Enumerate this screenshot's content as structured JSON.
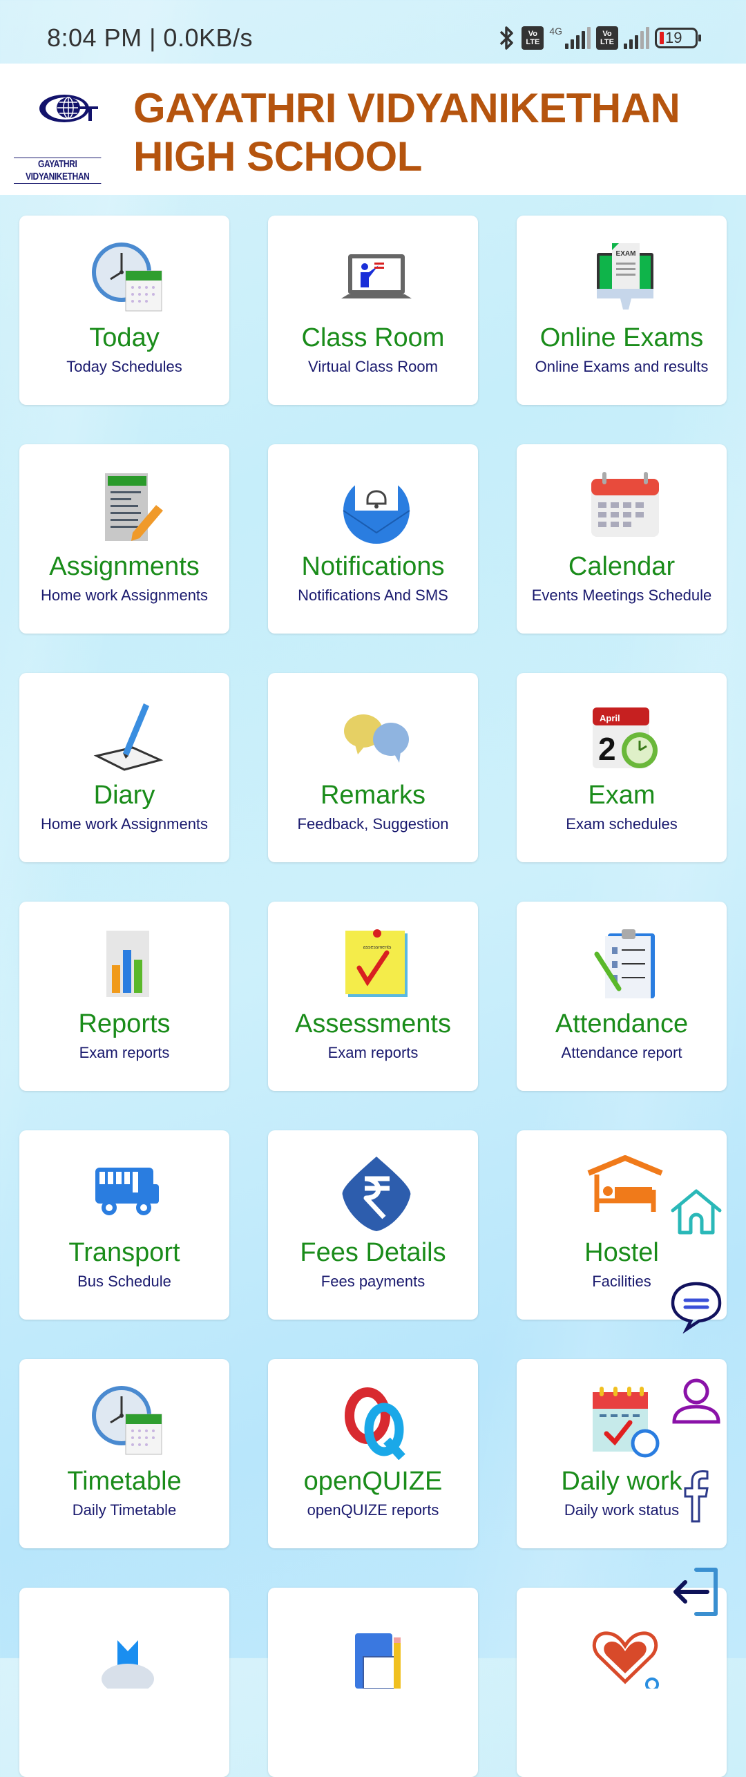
{
  "status_bar": {
    "time": "8:04 PM | 0.0KB/s",
    "network_type": "4G",
    "volte_label_top": "Vo",
    "volte_label_bottom": "LTE",
    "battery": "19",
    "icons": [
      "bluetooth-icon",
      "volte-icon",
      "signal-icon",
      "volte-icon",
      "signal-icon",
      "battery-icon"
    ]
  },
  "header": {
    "logo_caption": "GAYATHRI VIDYANIKETHAN",
    "school_name_line1": "GAYATHRI VIDYANIKETHAN",
    "school_name_line2": "HIGH SCHOOL"
  },
  "colors": {
    "title_green": "#1a8c1a",
    "subtitle_navy": "#1a1a6e",
    "school_name_orange": "#b5540e"
  },
  "tiles": [
    {
      "title": "Today",
      "subtitle": "Today Schedules",
      "icon": "clock-calendar-icon"
    },
    {
      "title": "Class Room",
      "subtitle": "Virtual Class Room",
      "icon": "laptop-teacher-icon"
    },
    {
      "title": "Online Exams",
      "subtitle": "Online Exams and results",
      "icon": "exam-monitor-icon"
    },
    {
      "title": "Assignments",
      "subtitle": "Home work Assignments",
      "icon": "document-pencil-icon"
    },
    {
      "title": "Notifications",
      "subtitle": "Notifications And SMS",
      "icon": "bell-envelope-icon"
    },
    {
      "title": "Calendar",
      "subtitle": "Events Meetings Schedule",
      "icon": "calendar-icon"
    },
    {
      "title": "Diary",
      "subtitle": "Home work Assignments",
      "icon": "notebook-pen-icon"
    },
    {
      "title": "Remarks",
      "subtitle": "Feedback, Suggestion",
      "icon": "thumbs-speech-icon"
    },
    {
      "title": "Exam",
      "subtitle": "Exam schedules",
      "icon": "calendar-clock-icon"
    },
    {
      "title": "Reports",
      "subtitle": "Exam reports",
      "icon": "report-chart-icon"
    },
    {
      "title": "Assessments",
      "subtitle": "Exam reports",
      "icon": "sticky-note-check-icon"
    },
    {
      "title": "Attendance",
      "subtitle": "Attendance report",
      "icon": "clipboard-icon"
    },
    {
      "title": "Transport",
      "subtitle": "Bus Schedule",
      "icon": "bus-icon"
    },
    {
      "title": "Fees Details",
      "subtitle": "Fees payments",
      "icon": "rupee-icon"
    },
    {
      "title": "Hostel",
      "subtitle": "Facilities",
      "icon": "bed-house-icon"
    },
    {
      "title": "Timetable",
      "subtitle": "Daily Timetable",
      "icon": "clock-calendar-icon"
    },
    {
      "title": "openQUIZE",
      "subtitle": "openQUIZE reports",
      "icon": "quiz-logo-icon"
    },
    {
      "title": "Daily work",
      "subtitle": "Daily work status",
      "icon": "calendar-check-icon"
    },
    {
      "title": "",
      "subtitle": "",
      "icon": "graduation-icon"
    },
    {
      "title": "",
      "subtitle": "",
      "icon": "notebook-pencil-icon"
    },
    {
      "title": "",
      "subtitle": "",
      "icon": "heart-stethoscope-icon"
    }
  ],
  "floating_actions": [
    {
      "name": "home-button",
      "icon": "home-icon"
    },
    {
      "name": "chat-button",
      "icon": "chat-icon"
    },
    {
      "name": "profile-button",
      "icon": "user-icon"
    },
    {
      "name": "facebook-button",
      "icon": "facebook-icon"
    },
    {
      "name": "logout-button",
      "icon": "logout-icon"
    }
  ]
}
